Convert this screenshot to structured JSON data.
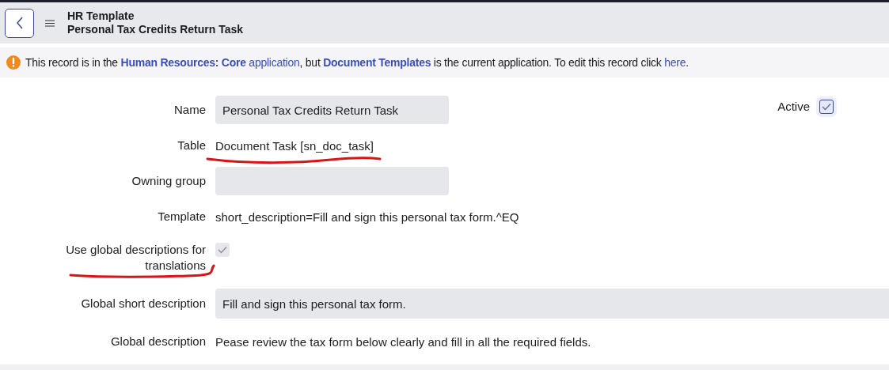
{
  "header": {
    "title": "HR Template",
    "subtitle": "Personal Tax Credits Return Task"
  },
  "notice": {
    "parts": [
      {
        "kind": "text",
        "text": "This record is in the "
      },
      {
        "kind": "link",
        "bold": true,
        "text": "Human Resources: Core"
      },
      {
        "kind": "link",
        "bold": false,
        "text": " application"
      },
      {
        "kind": "text",
        "text": ", but "
      },
      {
        "kind": "link",
        "bold": true,
        "text": "Document Templates"
      },
      {
        "kind": "text",
        "text": " is the current application. To edit this record click "
      },
      {
        "kind": "link",
        "bold": false,
        "text": "here"
      },
      {
        "kind": "text",
        "text": "."
      }
    ]
  },
  "fields": [
    {
      "kind": "input",
      "label": "Name",
      "value": "Personal Tax Credits Return Task"
    },
    {
      "kind": "text",
      "label": "Table",
      "value": "Document Task [sn_doc_task]",
      "underlined": true
    },
    {
      "kind": "input",
      "label": "Owning group"
    },
    {
      "kind": "text",
      "label": "Template",
      "value": "short_description=Fill and sign this personal tax form.^EQ"
    },
    {
      "kind": "checkbox",
      "label": "Use global descriptions for translations",
      "checked": true,
      "disabled": true,
      "underlined": true
    },
    {
      "kind": "input",
      "label": "Global short description",
      "value": "Fill and sign this personal tax form.",
      "wide": true
    },
    {
      "kind": "text",
      "label": "Global description",
      "value": "Pease review the tax form below clearly and fill in all the required fields."
    }
  ],
  "active": {
    "label": "Active",
    "checked": true,
    "disabled": false
  }
}
